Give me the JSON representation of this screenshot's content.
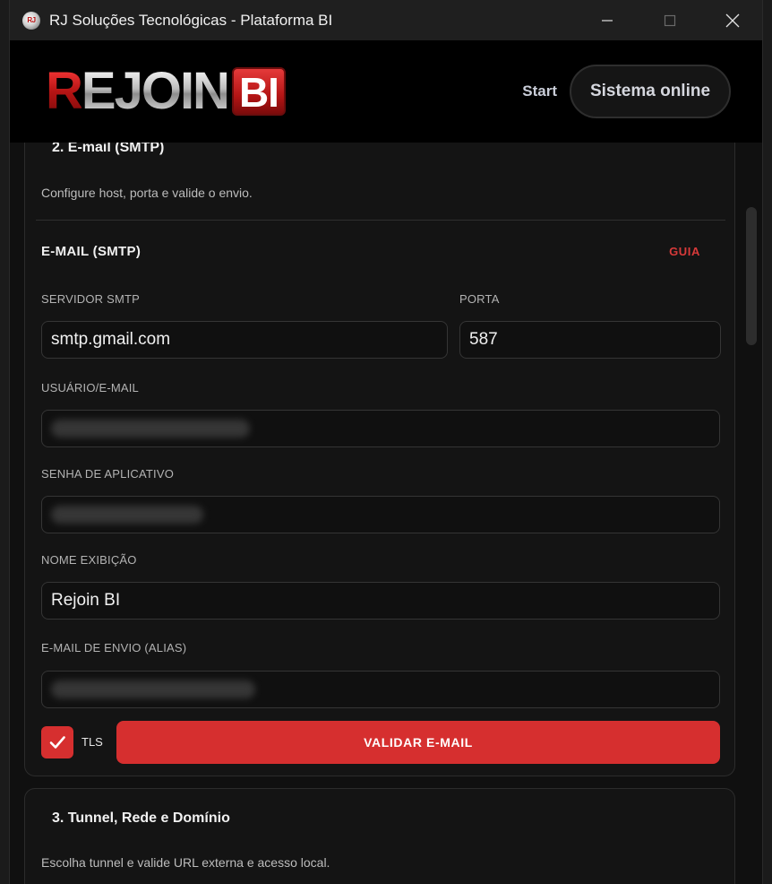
{
  "window": {
    "title": "RJ Soluções Tecnológicas - Plataforma BI",
    "icon_text": "RJ"
  },
  "header": {
    "logo_text_r": "R",
    "logo_text_rest": "EJOIN",
    "logo_text_bi": "BI",
    "nav_start": "Start",
    "status": "Sistema online"
  },
  "smtp_section": {
    "title": "2. E-mail (SMTP)",
    "description": "Configure host, porta e valide o envio.",
    "sub_title": "E-MAIL (SMTP)",
    "guide_link": "GUIA",
    "fields": {
      "server_label": "SERVIDOR SMTP",
      "server_value": "smtp.gmail.com",
      "port_label": "PORTA",
      "port_value": "587",
      "user_label": "USUÁRIO/E-MAIL",
      "password_label": "SENHA DE APLICATIVO",
      "display_name_label": "NOME EXIBIÇÃO",
      "display_name_value": "Rejoin BI",
      "alias_label": "E-MAIL DE ENVIO (ALIAS)"
    },
    "tls_label": "TLS",
    "tls_checked": true,
    "validate_button": "VALIDAR E-MAIL"
  },
  "tunnel_section": {
    "title": "3. Tunnel, Rede e Domínio",
    "description": "Escolha tunnel e valide URL externa e acesso local."
  },
  "colors": {
    "accent": "#d62f2f",
    "background": "#101010",
    "card": "#141414"
  }
}
